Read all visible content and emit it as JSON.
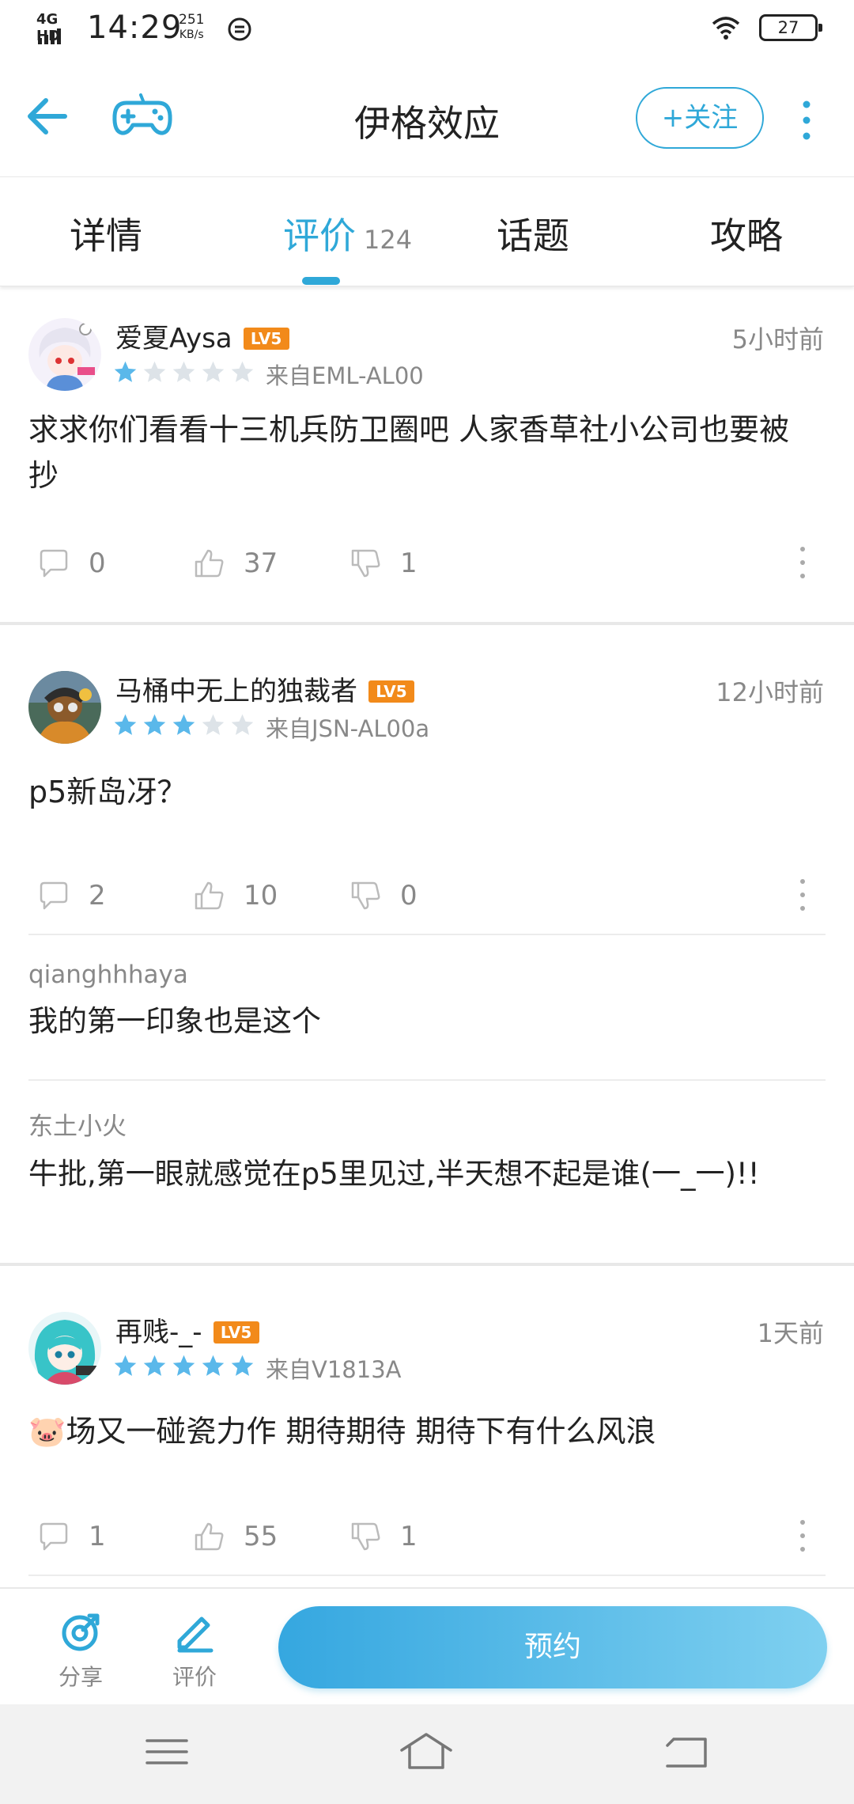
{
  "status_bar": {
    "network": "4G HD",
    "time": "14:29",
    "speed_value": "251",
    "speed_unit": "KB/s",
    "battery": "27"
  },
  "header": {
    "title": "伊格效应",
    "follow_label": "+关注",
    "back_icon": "arrow-left-icon",
    "game_icon": "gamepad-icon",
    "more_icon": "more-vertical-icon"
  },
  "tabs": [
    {
      "label": "详情"
    },
    {
      "label": "评价",
      "count": "124",
      "active": true
    },
    {
      "label": "话题"
    },
    {
      "label": "攻略"
    }
  ],
  "reviews": [
    {
      "username": "爱夏Aysa",
      "level": "LV5",
      "time": "5小时前",
      "rating": 1,
      "device": "来自EML-AL00",
      "text": "求求你们看看十三机兵防卫圈吧 人家香草社小公司也要被抄",
      "comments": "0",
      "likes": "37",
      "dislikes": "1"
    },
    {
      "username": "马桶中无上的独裁者",
      "level": "LV5",
      "time": "12小时前",
      "rating": 3,
      "device": "来自JSN-AL00a",
      "text": "p5新岛冴？",
      "comments": "2",
      "likes": "10",
      "dislikes": "0",
      "replies": [
        {
          "name": "qianghhhaya",
          "text": "我的第一印象也是这个"
        },
        {
          "name": "东土小火",
          "text": "牛批,第一眼就感觉在p5里见过,半天想不起是谁(一_一)!!"
        }
      ]
    },
    {
      "username": "再贱-_-",
      "level": "LV5",
      "time": "1天前",
      "rating": 5,
      "device": "来自V1813A",
      "text": "🐷场又一碰瓷力作 期待期待 期待下有什么风浪",
      "comments": "1",
      "likes": "55",
      "dislikes": "1"
    }
  ],
  "bottom_bar": {
    "share_label": "分享",
    "review_label": "评价",
    "reserve_label": "预约"
  },
  "colors": {
    "accent": "#2fa8d8",
    "star_on": "#5ab8ea",
    "star_off": "#dde3e8",
    "level_badge": "#f28a1a"
  }
}
